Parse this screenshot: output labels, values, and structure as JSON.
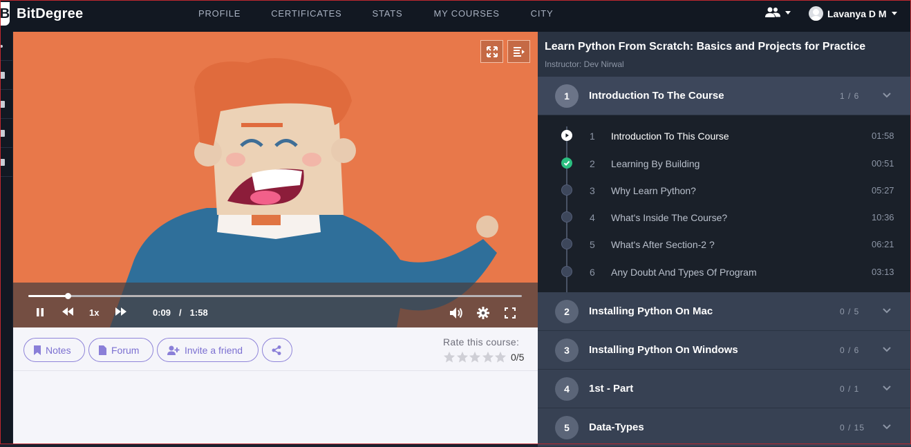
{
  "brand": {
    "name": "BitDegree"
  },
  "nav": {
    "items": [
      "PROFILE",
      "CERTIFICATES",
      "STATS",
      "MY COURSES",
      "CITY"
    ]
  },
  "user": {
    "name": "Lavanya D M"
  },
  "player": {
    "current_time": "0:09",
    "separator": "/",
    "duration": "1:58",
    "speed": "1x",
    "progress": 0.08
  },
  "actions": {
    "notes": "Notes",
    "forum": "Forum",
    "invite": "Invite a friend"
  },
  "rating": {
    "label": "Rate this course:",
    "score": "0/5",
    "stars_filled": 0,
    "stars_total": 5
  },
  "course": {
    "title": "Learn Python From Scratch: Basics and Projects for Practice",
    "instructor": "Instructor: Dev Nirwal"
  },
  "sections": [
    {
      "num": "1",
      "title": "Introduction To The Course",
      "count": "1 / 6"
    },
    {
      "num": "2",
      "title": "Installing Python On Mac",
      "count": "0 / 5"
    },
    {
      "num": "3",
      "title": "Installing Python On Windows",
      "count": "0 / 6"
    },
    {
      "num": "4",
      "title": "1st - Part",
      "count": "0 / 1"
    },
    {
      "num": "5",
      "title": "Data-Types",
      "count": "0 / 15"
    }
  ],
  "lessons": [
    {
      "num": "1",
      "title": "Introduction To This Course",
      "duration": "01:58",
      "state": "playing"
    },
    {
      "num": "2",
      "title": "Learning By Building",
      "duration": "00:51",
      "state": "done"
    },
    {
      "num": "3",
      "title": "Why Learn Python?",
      "duration": "05:27",
      "state": "todo"
    },
    {
      "num": "4",
      "title": "What's Inside The Course?",
      "duration": "10:36",
      "state": "todo"
    },
    {
      "num": "5",
      "title": "What's After Section-2 ?",
      "duration": "06:21",
      "state": "todo"
    },
    {
      "num": "6",
      "title": "Any Doubt And Types Of Program",
      "duration": "03:13",
      "state": "todo"
    }
  ],
  "colors": {
    "video_bg": "#e8784a",
    "accent_purple": "#7b6fd1",
    "done_green": "#2bbf80"
  }
}
